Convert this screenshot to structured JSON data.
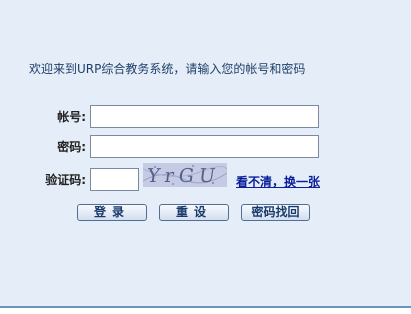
{
  "welcome_text": "欢迎来到URP综合教务系统，请输入您的帐号和密码",
  "form": {
    "account_label": "帐号:",
    "account_value": "",
    "password_label": "密码:",
    "password_value": "",
    "captcha_label": "验证码:",
    "captcha_value": "",
    "captcha_image_text": "YrGU",
    "refresh_captcha_link": "看不清，换一张"
  },
  "buttons": {
    "login": "登录",
    "reset": "重设",
    "recover": "密码找回"
  },
  "colors": {
    "panel_bg": "#e5edf8",
    "link": "#0a1f99",
    "welcome_text": "#1f3f68"
  }
}
